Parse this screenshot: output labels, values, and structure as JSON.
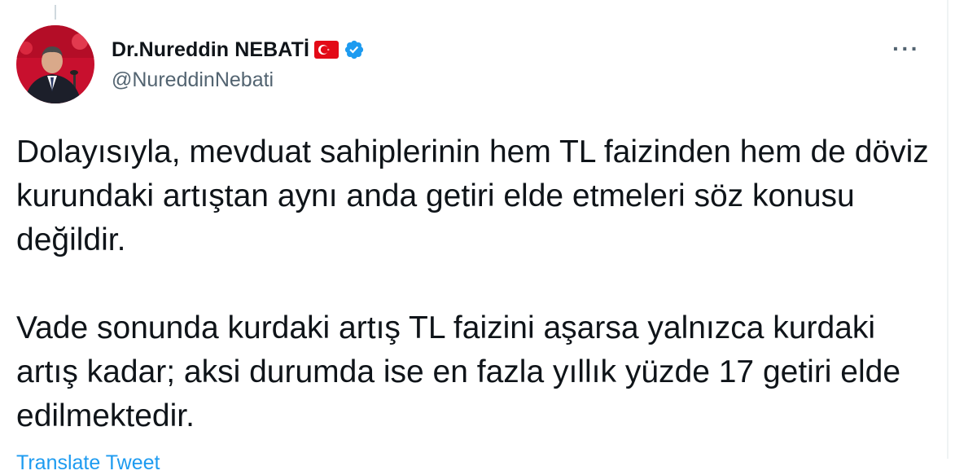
{
  "author": {
    "display_name": "Dr.Nureddin NEBATİ",
    "handle": "@NureddinNebati",
    "flag_emoji": "turkey-flag-icon",
    "verified": true
  },
  "tweet": {
    "paragraph_1": "Dolayısıyla, mevduat sahiplerinin hem TL faizinden hem de döviz kurundaki artıştan aynı anda getiri elde etmeleri söz konusu değildir.",
    "paragraph_2": "Vade sonunda kurdaki artış TL faizini aşarsa yalnızca kurdaki artış kadar; aksi durumda ise en fazla yıllık yüzde 17 getiri elde edilmektedir.",
    "translate_label": "Translate Tweet"
  },
  "more_button": {
    "label": "···"
  },
  "colors": {
    "text_primary": "#0f1419",
    "text_secondary": "#536471",
    "link": "#1d9bf0",
    "verified_badge": "#1d9bf0",
    "flag_red": "#e30a17"
  }
}
